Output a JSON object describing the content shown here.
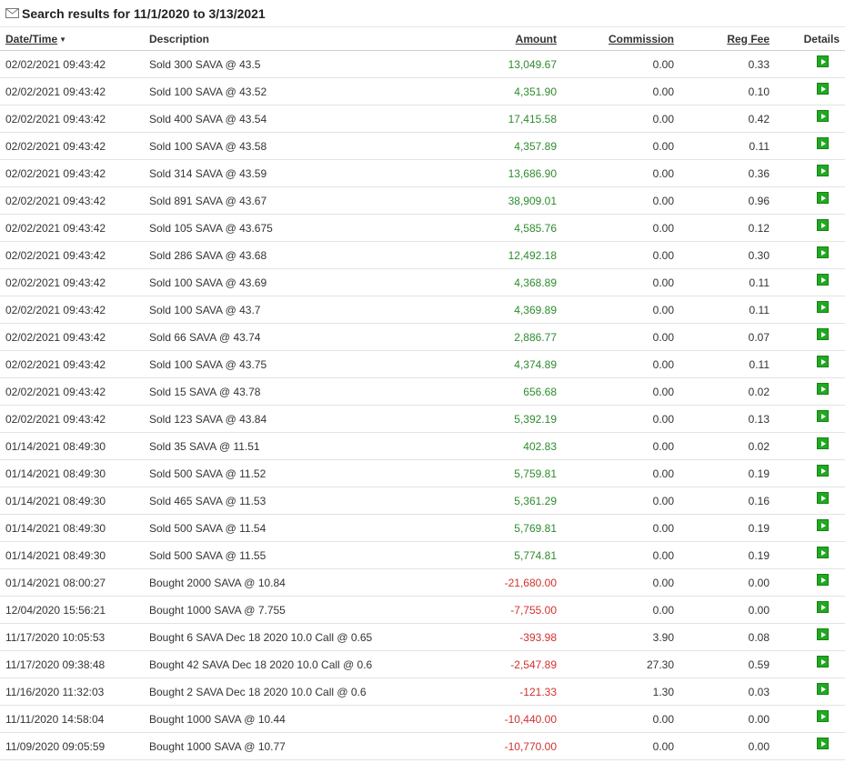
{
  "header": {
    "title": "Search results for 11/1/2020 to 3/13/2021",
    "icon": "mail-icon"
  },
  "columns": {
    "datetime": "Date/Time",
    "description": "Description",
    "amount": "Amount",
    "commission": "Commission",
    "reg_fee": "Reg Fee",
    "details": "Details"
  },
  "colors": {
    "positive": "#2e8b2e",
    "negative": "#d0312d",
    "detail_button": "#22a822"
  },
  "rows": [
    {
      "datetime": "02/02/2021  09:43:42",
      "description": "Sold 300 SAVA @ 43.5",
      "amount": "13,049.67",
      "commission": "0.00",
      "reg_fee": "0.33",
      "sign": "pos"
    },
    {
      "datetime": "02/02/2021  09:43:42",
      "description": "Sold 100 SAVA @ 43.52",
      "amount": "4,351.90",
      "commission": "0.00",
      "reg_fee": "0.10",
      "sign": "pos"
    },
    {
      "datetime": "02/02/2021  09:43:42",
      "description": "Sold 400 SAVA @ 43.54",
      "amount": "17,415.58",
      "commission": "0.00",
      "reg_fee": "0.42",
      "sign": "pos"
    },
    {
      "datetime": "02/02/2021  09:43:42",
      "description": "Sold 100 SAVA @ 43.58",
      "amount": "4,357.89",
      "commission": "0.00",
      "reg_fee": "0.11",
      "sign": "pos"
    },
    {
      "datetime": "02/02/2021  09:43:42",
      "description": "Sold 314 SAVA @ 43.59",
      "amount": "13,686.90",
      "commission": "0.00",
      "reg_fee": "0.36",
      "sign": "pos"
    },
    {
      "datetime": "02/02/2021  09:43:42",
      "description": "Sold 891 SAVA @ 43.67",
      "amount": "38,909.01",
      "commission": "0.00",
      "reg_fee": "0.96",
      "sign": "pos"
    },
    {
      "datetime": "02/02/2021  09:43:42",
      "description": "Sold 105 SAVA @ 43.675",
      "amount": "4,585.76",
      "commission": "0.00",
      "reg_fee": "0.12",
      "sign": "pos"
    },
    {
      "datetime": "02/02/2021  09:43:42",
      "description": "Sold 286 SAVA @ 43.68",
      "amount": "12,492.18",
      "commission": "0.00",
      "reg_fee": "0.30",
      "sign": "pos"
    },
    {
      "datetime": "02/02/2021  09:43:42",
      "description": "Sold 100 SAVA @ 43.69",
      "amount": "4,368.89",
      "commission": "0.00",
      "reg_fee": "0.11",
      "sign": "pos"
    },
    {
      "datetime": "02/02/2021  09:43:42",
      "description": "Sold 100 SAVA @ 43.7",
      "amount": "4,369.89",
      "commission": "0.00",
      "reg_fee": "0.11",
      "sign": "pos"
    },
    {
      "datetime": "02/02/2021  09:43:42",
      "description": "Sold 66 SAVA @ 43.74",
      "amount": "2,886.77",
      "commission": "0.00",
      "reg_fee": "0.07",
      "sign": "pos"
    },
    {
      "datetime": "02/02/2021  09:43:42",
      "description": "Sold 100 SAVA @ 43.75",
      "amount": "4,374.89",
      "commission": "0.00",
      "reg_fee": "0.11",
      "sign": "pos"
    },
    {
      "datetime": "02/02/2021  09:43:42",
      "description": "Sold 15 SAVA @ 43.78",
      "amount": "656.68",
      "commission": "0.00",
      "reg_fee": "0.02",
      "sign": "pos"
    },
    {
      "datetime": "02/02/2021  09:43:42",
      "description": "Sold 123 SAVA @ 43.84",
      "amount": "5,392.19",
      "commission": "0.00",
      "reg_fee": "0.13",
      "sign": "pos"
    },
    {
      "datetime": "01/14/2021  08:49:30",
      "description": "Sold 35 SAVA @ 11.51",
      "amount": "402.83",
      "commission": "0.00",
      "reg_fee": "0.02",
      "sign": "pos"
    },
    {
      "datetime": "01/14/2021  08:49:30",
      "description": "Sold 500 SAVA @ 11.52",
      "amount": "5,759.81",
      "commission": "0.00",
      "reg_fee": "0.19",
      "sign": "pos"
    },
    {
      "datetime": "01/14/2021  08:49:30",
      "description": "Sold 465 SAVA @ 11.53",
      "amount": "5,361.29",
      "commission": "0.00",
      "reg_fee": "0.16",
      "sign": "pos"
    },
    {
      "datetime": "01/14/2021  08:49:30",
      "description": "Sold 500 SAVA @ 11.54",
      "amount": "5,769.81",
      "commission": "0.00",
      "reg_fee": "0.19",
      "sign": "pos"
    },
    {
      "datetime": "01/14/2021  08:49:30",
      "description": "Sold 500 SAVA @ 11.55",
      "amount": "5,774.81",
      "commission": "0.00",
      "reg_fee": "0.19",
      "sign": "pos"
    },
    {
      "datetime": "01/14/2021  08:00:27",
      "description": "Bought 2000 SAVA @ 10.84",
      "amount": "-21,680.00",
      "commission": "0.00",
      "reg_fee": "0.00",
      "sign": "neg"
    },
    {
      "datetime": "12/04/2020  15:56:21",
      "description": "Bought 1000 SAVA @ 7.755",
      "amount": "-7,755.00",
      "commission": "0.00",
      "reg_fee": "0.00",
      "sign": "neg"
    },
    {
      "datetime": "11/17/2020  10:05:53",
      "description": "Bought 6 SAVA Dec 18 2020 10.0 Call @ 0.65",
      "amount": "-393.98",
      "commission": "3.90",
      "reg_fee": "0.08",
      "sign": "neg"
    },
    {
      "datetime": "11/17/2020  09:38:48",
      "description": "Bought 42 SAVA Dec 18 2020 10.0 Call @ 0.6",
      "amount": "-2,547.89",
      "commission": "27.30",
      "reg_fee": "0.59",
      "sign": "neg"
    },
    {
      "datetime": "11/16/2020  11:32:03",
      "description": "Bought 2 SAVA Dec 18 2020 10.0 Call @ 0.6",
      "amount": "-121.33",
      "commission": "1.30",
      "reg_fee": "0.03",
      "sign": "neg"
    },
    {
      "datetime": "11/11/2020  14:58:04",
      "description": "Bought 1000 SAVA @ 10.44",
      "amount": "-10,440.00",
      "commission": "0.00",
      "reg_fee": "0.00",
      "sign": "neg"
    },
    {
      "datetime": "11/09/2020  09:05:59",
      "description": "Bought 1000 SAVA @ 10.77",
      "amount": "-10,770.00",
      "commission": "0.00",
      "reg_fee": "0.00",
      "sign": "neg"
    }
  ]
}
